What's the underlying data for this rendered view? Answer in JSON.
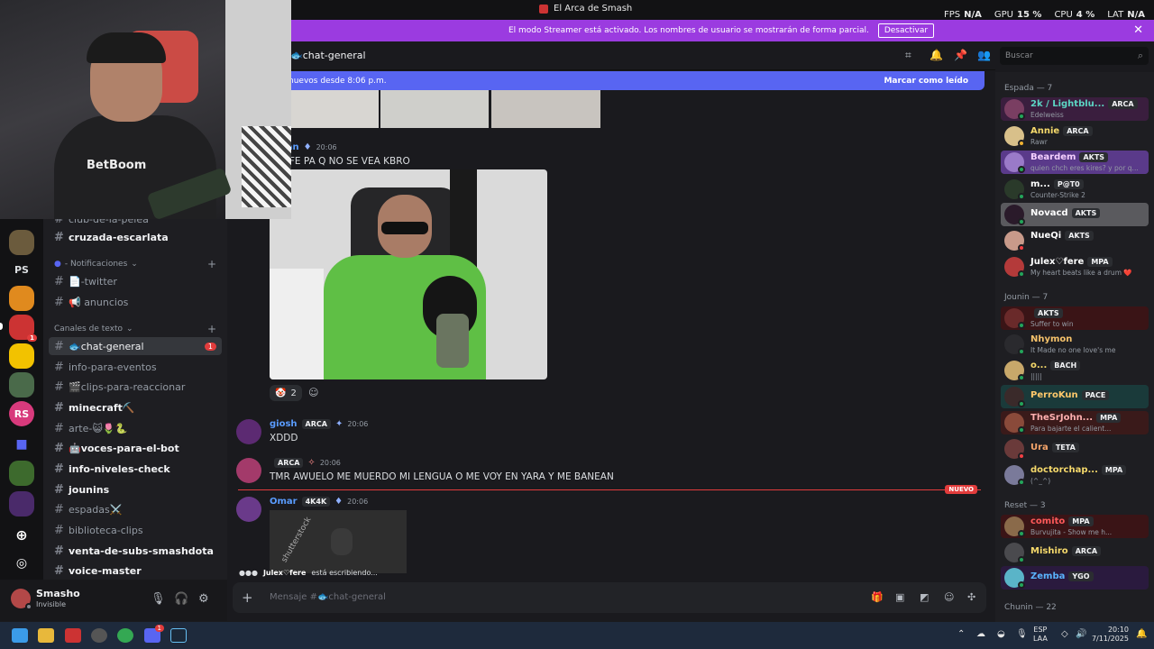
{
  "window": {
    "title": "El Arca de Smash"
  },
  "perf": [
    {
      "label": "FPS",
      "value": "N/A"
    },
    {
      "label": "GPU",
      "value": "15 %"
    },
    {
      "label": "CPU",
      "value": "4 %"
    },
    {
      "label": "LAT",
      "value": "N/A"
    }
  ],
  "streamer_banner": {
    "text": "El modo Streamer está activado. Los nombres de usuario se mostrarán de forma parcial.",
    "button": "Desactivar",
    "close": "✕"
  },
  "webcam": {
    "shirt_brand": "BetBoom"
  },
  "rail": {
    "ps_label": "PS",
    "rs_label": "RS",
    "badge": "1"
  },
  "channels": {
    "partial_top": "club-de-la-pelea",
    "items_a": [
      {
        "name": "cruzada-escarlata"
      }
    ],
    "cat_notif": "- Notificaciones",
    "notif": [
      {
        "name": "📄-twitter"
      },
      {
        "name": "📢 anuncios"
      }
    ],
    "cat_text": "Canales de texto",
    "text": [
      {
        "name": "🐟chat-general",
        "badge": "1"
      },
      {
        "name": "info-para-eventos"
      },
      {
        "name": "🎬clips-para-reaccionar"
      },
      {
        "name": "minecraft⛏️"
      },
      {
        "name": "arte-😺🌷🐍"
      },
      {
        "name": "🤖voces-para-el-bot"
      },
      {
        "name": "info-niveles-check"
      },
      {
        "name": "jounins"
      },
      {
        "name": "espadas⚔️"
      },
      {
        "name": "biblioteca-clips"
      },
      {
        "name": "venta-de-subs-smashdota"
      },
      {
        "name": "voice-master"
      }
    ]
  },
  "user": {
    "name": "Smasho",
    "status": "Invisible"
  },
  "chat": {
    "channel": "🐟chat-general",
    "new_banner": "nuevos desde 8:06 p.m.",
    "mark_read": "Marcar como leído",
    "messages": [
      {
        "user": "Satan",
        "time": "20:06",
        "text": "PROFE PA Q NO SE VEA KBRO"
      },
      {
        "reaction_count": "2"
      },
      {
        "user": "giosh",
        "tag": "ARCA",
        "time": "20:06",
        "text": "XDDD"
      },
      {
        "user": "",
        "tag": "ARCA",
        "time": "20:06",
        "text": "TMR AWUELO ME MUERDO MI LENGUA O ME VOY EN YARA Y ME BANEAN"
      },
      {
        "user": "Omar",
        "tag": "4K4K",
        "time": "20:06"
      }
    ],
    "nuevo": "NUEVO",
    "thumb_watermark": "shutterstock",
    "typing_user": "Julex♡fere",
    "typing_text": "está escribiendo...",
    "composer_placeholder": "Mensaje #🐟chat-general"
  },
  "search": {
    "placeholder": "Buscar"
  },
  "members": {
    "groups": [
      {
        "title": "Espada — 7"
      },
      {
        "title": "Jounin — 7"
      },
      {
        "title": "Reset — 3"
      },
      {
        "title": "Chunin — 22"
      }
    ],
    "list": [
      {
        "name": "2k / Lightblu...",
        "tag": "ARCA",
        "status": "Edelweiss",
        "color": "#5cd6c4"
      },
      {
        "name": "Annie",
        "tag": "ARCA",
        "status": "Rawr",
        "color": "#f5d96b"
      },
      {
        "name": "Beardem",
        "tag": "AKTS",
        "status": "quien chch eres kires? y por q...",
        "color": "#f5d0ff"
      },
      {
        "name": "m...",
        "tag": "P@T0",
        "status": "Counter-Strike 2",
        "color": "#ffffff"
      },
      {
        "name": "Novacd",
        "tag": "AKTS",
        "status": "",
        "color": "#ffffff"
      },
      {
        "name": "NueQi",
        "tag": "AKTS",
        "status": "",
        "color": "#ffffff"
      },
      {
        "name": "Julex♡fere",
        "tag": "MPA",
        "status": "My heart beats like a drum ❤️",
        "color": "#ffffff"
      },
      {
        "name": "",
        "tag": "AKTS",
        "status": "Suffer to win",
        "color": "#e23c3c"
      },
      {
        "name": "Nhymon",
        "tag": "",
        "status": "It Made no one love's me",
        "color": "#f5c26b"
      },
      {
        "name": "o...",
        "tag": "BACH",
        "status": "|||||",
        "color": "#f5d96b"
      },
      {
        "name": "PerroKun",
        "tag": "PACE",
        "status": "",
        "color": "#ffc96b"
      },
      {
        "name": "TheSrJohn...",
        "tag": "MPA",
        "status": "Para bajarte el calient...",
        "color": "#ffb0b0"
      },
      {
        "name": "Ura",
        "tag": "TETA",
        "status": "",
        "color": "#f5a56b"
      },
      {
        "name": "doctorchap...",
        "tag": "MPA",
        "status": "(^_^)",
        "color": "#f5d96b"
      },
      {
        "name": "comito",
        "tag": "MPA",
        "status": "Burvujita - Show me h...",
        "color": "#ff5a5a"
      },
      {
        "name": "Mishiro",
        "tag": "ARCA",
        "status": "",
        "color": "#f5d96b"
      },
      {
        "name": "Zemba",
        "tag": "YGO",
        "status": "",
        "color": "#5ab4ff"
      }
    ]
  },
  "taskbar": {
    "lang_a": "ESP",
    "lang_b": "LAA",
    "time": "20:10",
    "date": "7/11/2025",
    "badge": "1"
  }
}
